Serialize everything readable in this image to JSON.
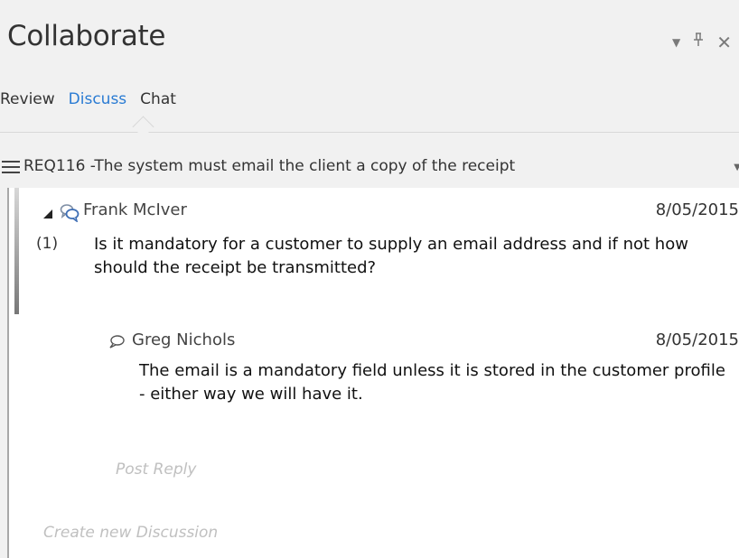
{
  "window": {
    "title": "Collaborate",
    "controls": {
      "menu": "▾",
      "pin": "ꟷ",
      "close": "✕"
    }
  },
  "tabs": [
    {
      "label": "Review",
      "active": false
    },
    {
      "label": "Discuss",
      "active": true
    },
    {
      "label": "Chat",
      "active": false
    }
  ],
  "requirement": {
    "label": "REQ116 -The system must email the client a copy of the receipt"
  },
  "discussion": {
    "author": "Frank McIver",
    "date": "8/05/2015",
    "number": "(1)",
    "text": "Is it mandatory for a customer to supply an email address and if not how should the receipt be transmitted?",
    "reply": {
      "author": "Greg Nichols",
      "date": "8/05/2015",
      "text": "The email is a  mandatory field unless it is stored in the customer  profile - either way we will have it."
    },
    "post_reply_placeholder": "Post Reply"
  },
  "create_new_discussion": "Create new Discussion",
  "colors": {
    "accent": "#2a7bd3",
    "panel_bg": "#f1f1f1",
    "content_bg": "#ffffff",
    "placeholder": "#c0c0c0"
  }
}
